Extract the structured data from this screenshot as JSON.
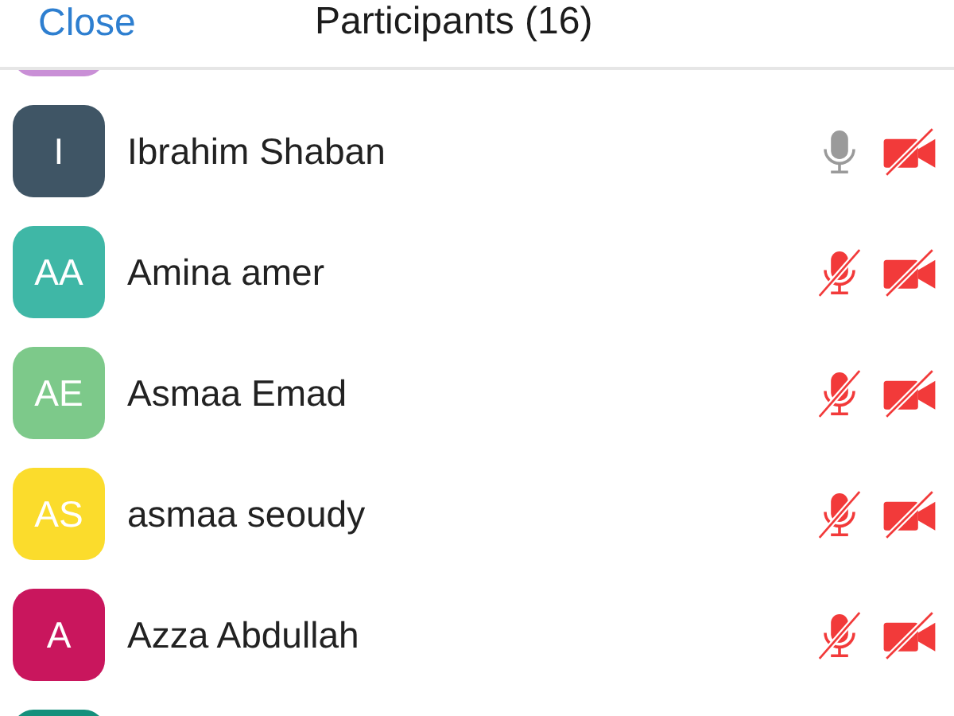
{
  "header": {
    "close": "Close",
    "title": "Participants (16)"
  },
  "clipped_above": {
    "color": "#c98fd6"
  },
  "participants": [
    {
      "initials": "I",
      "name": "Ibrahim Shaban",
      "color": "#3f5565",
      "muted": false,
      "video_on": false
    },
    {
      "initials": "AA",
      "name": "Amina amer",
      "color": "#3fb7a6",
      "muted": true,
      "video_on": false
    },
    {
      "initials": "AE",
      "name": "Asmaa Emad",
      "color": "#7dc98a",
      "muted": true,
      "video_on": false
    },
    {
      "initials": "AS",
      "name": "asmaa seoudy",
      "color": "#fbdc2c",
      "muted": true,
      "video_on": false
    },
    {
      "initials": "A",
      "name": "Azza Abdullah",
      "color": "#c9165d",
      "muted": true,
      "video_on": false
    }
  ],
  "clipped_below": {
    "color": "#15907c"
  }
}
